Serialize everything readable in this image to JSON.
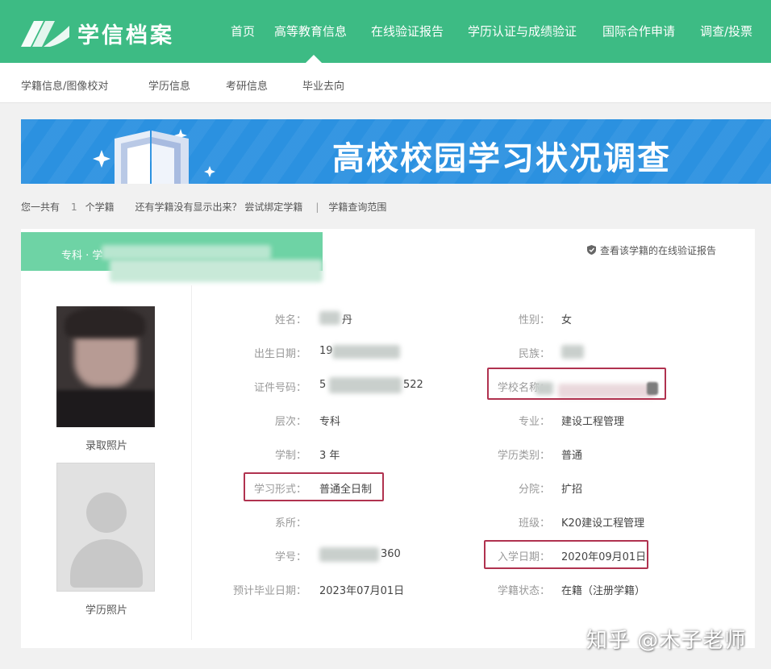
{
  "header": {
    "logo_text": "学信档案",
    "nav": [
      "首页",
      "高等教育信息",
      "在线验证报告",
      "学历认证与成绩验证",
      "国际合作申请",
      "调查/投票"
    ]
  },
  "subnav": [
    "学籍信息/图像校对",
    "学历信息",
    "考研信息",
    "毕业去向"
  ],
  "banner": {
    "title": "高校校园学习状况调查"
  },
  "infoline": {
    "prefix": "您一共有",
    "count": "1",
    "suffix": "个学籍",
    "bind_hint": "还有学籍没有显示出来？ 尝试绑定学籍",
    "sep": "|",
    "range_link": "学籍查询范围"
  },
  "record": {
    "tag": "专科 · 学",
    "verify_link": "查看该学籍的在线验证报告",
    "photo1_caption": "录取照片",
    "photo2_caption": "学历照片",
    "fields_left": [
      {
        "label": "姓名：",
        "value": "丹"
      },
      {
        "label": "出生日期：",
        "value": "19"
      },
      {
        "label": "证件号码：",
        "value": "5"
      },
      {
        "label": "层次：",
        "value": "专科"
      },
      {
        "label": "学制：",
        "value": "3 年"
      },
      {
        "label": "学习形式：",
        "value": "普通全日制"
      },
      {
        "label": "系所：",
        "value": ""
      },
      {
        "label": "学号：",
        "value": "360"
      },
      {
        "label": "预计毕业日期：",
        "value": "2023年07月01日"
      }
    ],
    "id_tail": "522",
    "fields_right": [
      {
        "label": "性别：",
        "value": "女"
      },
      {
        "label": "民族：",
        "value": ""
      },
      {
        "label": "学校名称：",
        "value": ""
      },
      {
        "label": "专业：",
        "value": "建设工程管理"
      },
      {
        "label": "学历类别：",
        "value": "普通"
      },
      {
        "label": "分院：",
        "value": "扩招"
      },
      {
        "label": "班级：",
        "value": "K20建设工程管理"
      },
      {
        "label": "入学日期：",
        "value": "2020年09月01日"
      },
      {
        "label": "学籍状态：",
        "value": "在籍（注册学籍）"
      }
    ]
  },
  "watermark": "知乎 @木子老师",
  "colors": {
    "header_green": "#3dbb84",
    "banner_blue": "#2b91e0",
    "highlight_box": "#b0324f"
  }
}
